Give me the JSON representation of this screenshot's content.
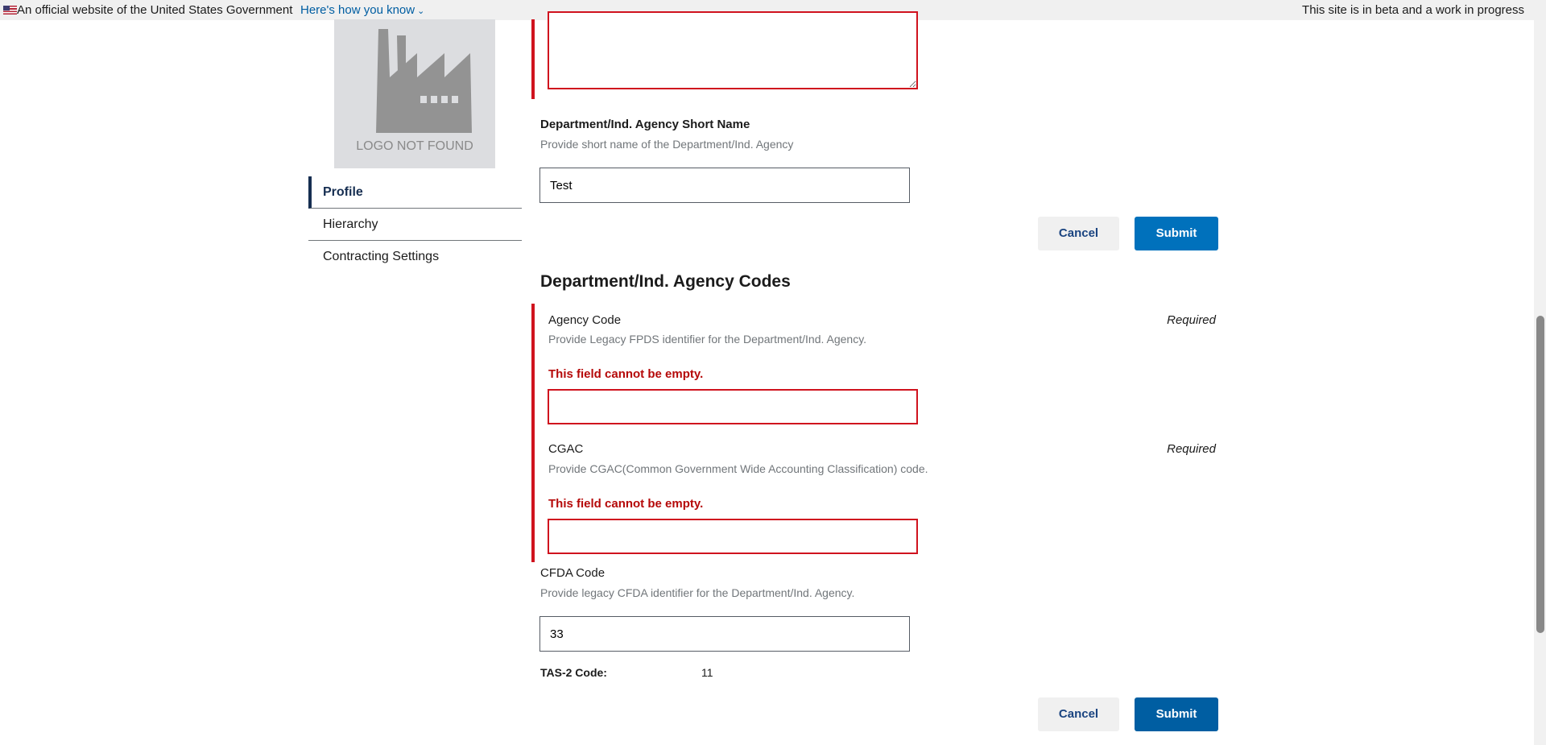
{
  "banner": {
    "official": "An official website of the United States Government",
    "how_you_know": "Here's how you know",
    "beta": "This site is in beta and a work in progress"
  },
  "logo": {
    "text": "LOGO NOT FOUND"
  },
  "sidebar": {
    "items": [
      {
        "label": "Profile",
        "active": true
      },
      {
        "label": "Hierarchy"
      },
      {
        "label": "Contracting Settings"
      }
    ]
  },
  "short_name": {
    "label": "Department/Ind. Agency Short Name",
    "help": "Provide short name of the Department/Ind. Agency",
    "value": "Test"
  },
  "buttons": {
    "cancel": "Cancel",
    "submit": "Submit"
  },
  "codes": {
    "heading": "Department/Ind. Agency Codes",
    "agency_code": {
      "label": "Agency Code",
      "required": "Required",
      "help": "Provide Legacy FPDS identifier for the Department/Ind. Agency.",
      "error": "This field cannot be empty.",
      "value": ""
    },
    "cgac": {
      "label": "CGAC",
      "required": "Required",
      "help": "Provide CGAC(Common Government Wide Accounting Classification) code.",
      "error": "This field cannot be empty.",
      "value": ""
    },
    "cfda": {
      "label": "CFDA Code",
      "help": "Provide legacy CFDA identifier for the Department/Ind. Agency.",
      "value": "33"
    },
    "tas2": {
      "label": "TAS-2 Code:",
      "value": "11"
    }
  },
  "colors": {
    "error": "#d0131e",
    "primary": "#0071bc",
    "primary_dark": "#005ea2"
  }
}
